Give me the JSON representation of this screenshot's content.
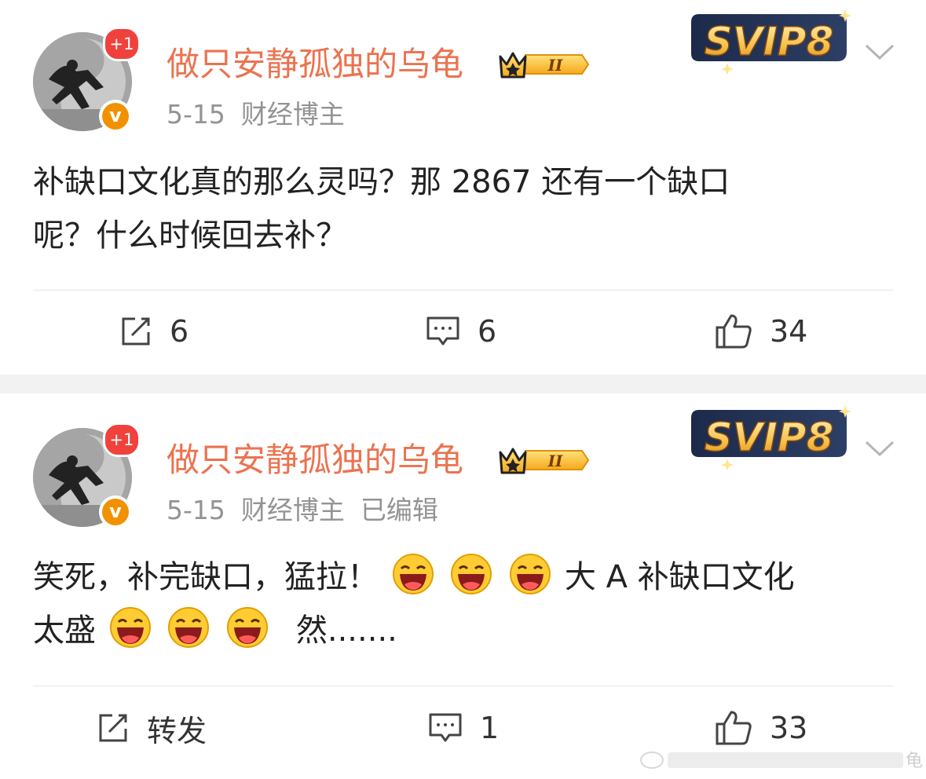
{
  "posts": [
    {
      "notification_badge": "+1",
      "verified_badge": "v",
      "username": "做只安静孤独的乌龟",
      "crown_badge_label": "II",
      "svip_label": "SVIP8",
      "date": "5-15",
      "category": "财经博主",
      "edited": "",
      "content_lines": [
        "补缺口文化真的那么灵吗？那 2867 还有一个缺口",
        "呢？什么时候回去补？"
      ],
      "actions": {
        "repost": "6",
        "comment": "6",
        "like": "34"
      }
    },
    {
      "notification_badge": "+1",
      "verified_badge": "v",
      "username": "做只安静孤独的乌龟",
      "crown_badge_label": "II",
      "svip_label": "SVIP8",
      "date": "5-15",
      "category": "财经博主",
      "edited": "已编辑",
      "content_line1_a": "笑死，补完缺口，猛拉！",
      "content_line1_b": "大 A 补缺口文化",
      "content_line2_a": "太盛",
      "content_line2_b": "然.......",
      "actions": {
        "repost": "转发",
        "comment": "1",
        "like": "33"
      }
    }
  ],
  "icons": {
    "repost": "repost-icon",
    "comment": "comment-icon",
    "like": "thumbs-up-icon",
    "more": "chevron-down-icon",
    "emoji": "laughing-emoji-icon"
  },
  "colors": {
    "username": "#eb7350",
    "meta": "#939393",
    "badge_red": "#f0413c",
    "verified_orange": "#f29100",
    "separator": "#f2f2f2"
  },
  "watermark_text": "微博"
}
